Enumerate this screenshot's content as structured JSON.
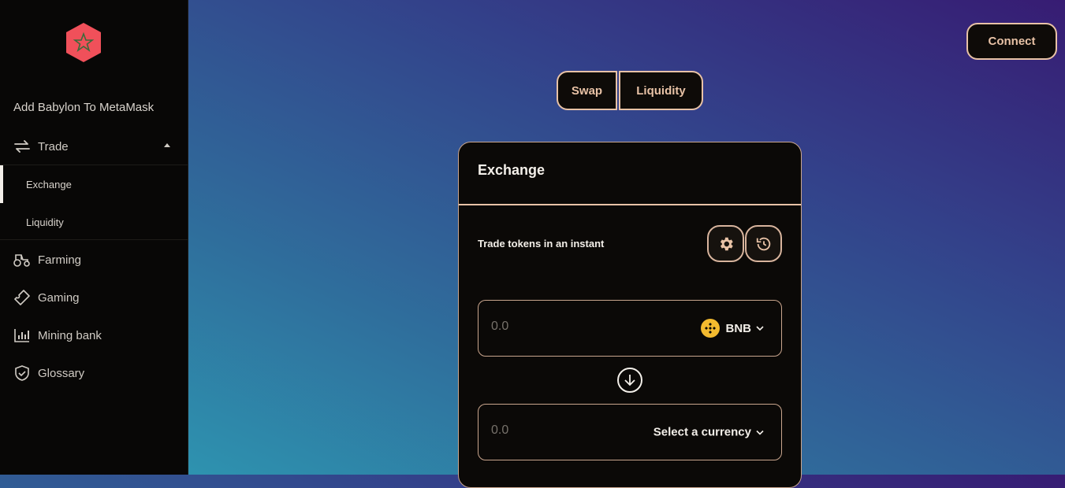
{
  "sidebar": {
    "add_metamask": "Add Babylon To MetaMask",
    "trade": "Trade",
    "sub_items": [
      "Exchange",
      "Liquidity"
    ],
    "farming": "Farming",
    "gaming": "Gaming",
    "mining_bank": "Mining bank",
    "glossary": "Glossary"
  },
  "header": {
    "connect": "Connect"
  },
  "tabs": {
    "swap": "Swap",
    "liquidity": "Liquidity"
  },
  "card": {
    "title": "Exchange",
    "subtitle": "Trade tokens in an instant",
    "from": {
      "amount_placeholder": "0.0",
      "token": "BNB"
    },
    "to": {
      "amount_placeholder": "0.0",
      "token": "Select a currency"
    }
  },
  "colors": {
    "accent": "#e8c2a6",
    "logo": "#f0505a",
    "bnb": "#f3ba2f",
    "panel": "#0b0907"
  }
}
